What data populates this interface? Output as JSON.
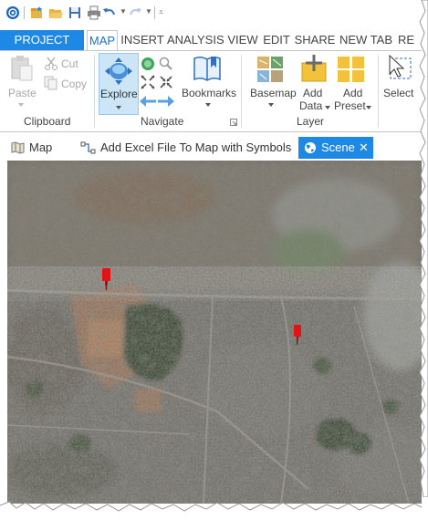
{
  "quick_access": {
    "icons": [
      "app-icon",
      "new-project-icon",
      "open-project-icon",
      "save-icon",
      "print-icon",
      "undo-icon",
      "redo-icon",
      "customize-icon"
    ]
  },
  "ribbon_tabs": [
    {
      "label": "PROJECT"
    },
    {
      "label": "MAP"
    },
    {
      "label": "INSERT"
    },
    {
      "label": "ANALYSIS"
    },
    {
      "label": "VIEW"
    },
    {
      "label": "EDIT"
    },
    {
      "label": "SHARE"
    },
    {
      "label": "NEW TAB"
    },
    {
      "label": "RE"
    }
  ],
  "ribbon": {
    "clipboard": {
      "label": "Clipboard",
      "paste": "Paste",
      "cut": "Cut",
      "copy": "Copy"
    },
    "navigate": {
      "label": "Navigate",
      "explore": "Explore",
      "bookmarks": "Bookmarks"
    },
    "layer": {
      "label": "Layer",
      "basemap": "Basemap",
      "add_data_line1": "Add",
      "add_data_line2": "Data",
      "add_preset_line1": "Add",
      "add_preset_line2": "Preset"
    },
    "selection": {
      "select": "Select"
    }
  },
  "view_tabs": [
    {
      "label": "Map"
    },
    {
      "label": "Add Excel File To Map with Symbols"
    },
    {
      "label": "Scene",
      "close": "✕"
    }
  ],
  "colors": {
    "accent": "#1e88e5",
    "marker": "#e01414"
  }
}
